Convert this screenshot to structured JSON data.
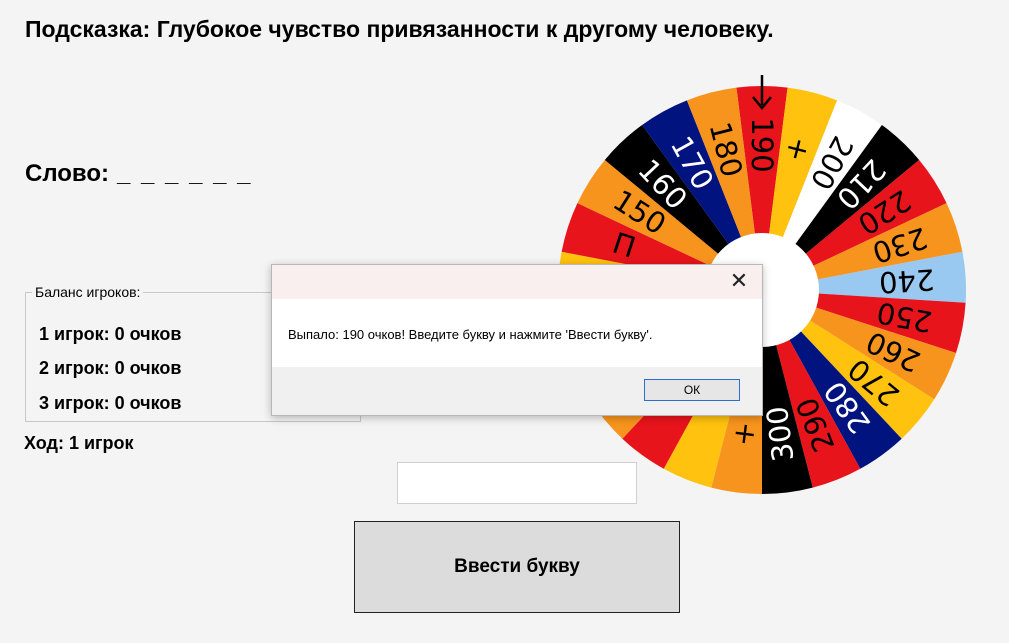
{
  "hint": "Подсказка: Глубокое чувство привязанности к другому человеку.",
  "word": {
    "label": "Слово:",
    "mask": "_ _ _ _ _ _"
  },
  "balance": {
    "legend": "Баланс игроков:",
    "players": [
      "1 игрок: 0 очков",
      "2 игрок: 0 очков",
      "3 игрок: 0 очков"
    ]
  },
  "turn": "Ход: 1 игрок",
  "input": {
    "value": "",
    "placeholder": ""
  },
  "enter_button": "Ввести букву",
  "wheel": {
    "pointer_icon": "down-arrow-icon",
    "sectors": [
      {
        "label": "190",
        "bg": "#e8141b",
        "fg": "#000000"
      },
      {
        "label": "+",
        "bg": "#ffc20e",
        "fg": "#000000"
      },
      {
        "label": "200",
        "bg": "#ffffff",
        "fg": "#000000"
      },
      {
        "label": "210",
        "bg": "#000000",
        "fg": "#ffffff"
      },
      {
        "label": "220",
        "bg": "#e8141b",
        "fg": "#000000"
      },
      {
        "label": "230",
        "bg": "#f7941d",
        "fg": "#000000"
      },
      {
        "label": "240",
        "bg": "#99c8f0",
        "fg": "#000000"
      },
      {
        "label": "250",
        "bg": "#e8141b",
        "fg": "#000000"
      },
      {
        "label": "260",
        "bg": "#f7941d",
        "fg": "#000000"
      },
      {
        "label": "270",
        "bg": "#ffc20e",
        "fg": "#000000"
      },
      {
        "label": "280",
        "bg": "#00137f",
        "fg": "#ffffff"
      },
      {
        "label": "290",
        "bg": "#e8141b",
        "fg": "#000000"
      },
      {
        "label": "300",
        "bg": "#000000",
        "fg": "#ffffff"
      },
      {
        "label": "+",
        "bg": "#f7941d",
        "fg": "#000000"
      },
      {
        "label": "",
        "bg": "#ffc20e",
        "fg": "#000000"
      },
      {
        "label": "",
        "bg": "#e8141b",
        "fg": "#000000"
      },
      {
        "label": "",
        "bg": "#f7941d",
        "fg": "#000000"
      },
      {
        "label": "",
        "bg": "#00137f",
        "fg": "#ffffff"
      },
      {
        "label": "",
        "bg": "#e8141b",
        "fg": "#000000"
      },
      {
        "label": "",
        "bg": "#ffc20e",
        "fg": "#000000"
      },
      {
        "label": "П",
        "bg": "#e8141b",
        "fg": "#000000"
      },
      {
        "label": "150",
        "bg": "#f7941d",
        "fg": "#000000"
      },
      {
        "label": "160",
        "bg": "#000000",
        "fg": "#ffffff"
      },
      {
        "label": "170",
        "bg": "#00137f",
        "fg": "#ffffff"
      },
      {
        "label": "180",
        "bg": "#f7941d",
        "fg": "#000000"
      }
    ]
  },
  "dialog": {
    "message": "Выпало: 190 очков! Введите букву и нажмите 'Ввести букву'.",
    "ok_label": "ОК",
    "close_icon": "close-icon",
    "close_glyph": "✕"
  }
}
